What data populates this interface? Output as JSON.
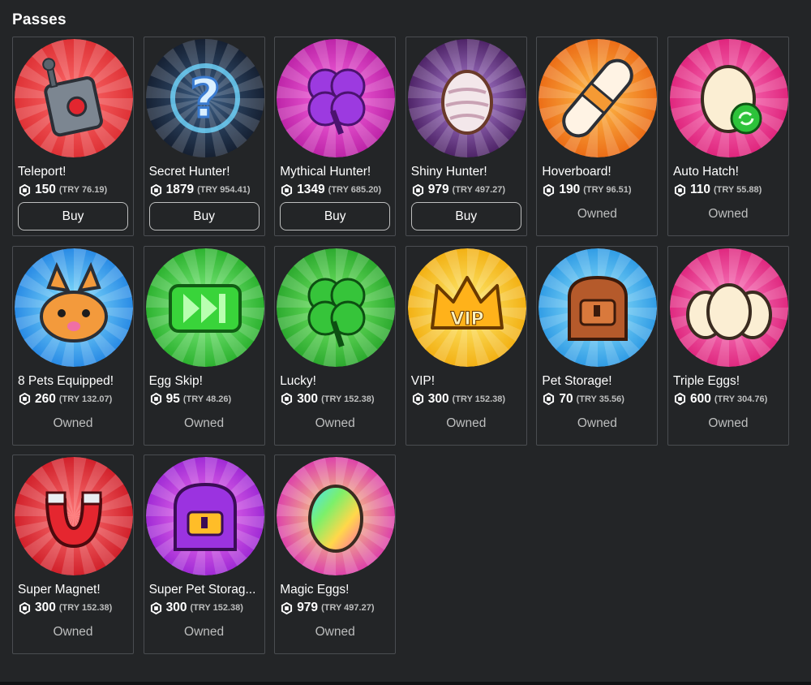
{
  "section_title": "Passes",
  "currency_icon": "robux-icon",
  "passes": [
    {
      "name": "Teleport!",
      "price": "150",
      "local_price": "(TRY 76.19)",
      "status": "buy",
      "button_label": "Buy",
      "icon": "teleport-icon",
      "bg": [
        "#ff6f6f",
        "#d8262b"
      ]
    },
    {
      "name": "Secret Hunter!",
      "price": "1879",
      "local_price": "(TRY 954.41)",
      "status": "buy",
      "button_label": "Buy",
      "icon": "secret-hunter-icon",
      "bg": [
        "#3d5f86",
        "#0e1422"
      ]
    },
    {
      "name": "Mythical Hunter!",
      "price": "1349",
      "local_price": "(TRY 685.20)",
      "status": "buy",
      "button_label": "Buy",
      "icon": "mythical-hunter-icon",
      "bg": [
        "#ff6ee6",
        "#b0169c"
      ]
    },
    {
      "name": "Shiny Hunter!",
      "price": "979",
      "local_price": "(TRY 497.27)",
      "status": "buy",
      "button_label": "Buy",
      "icon": "shiny-hunter-icon",
      "bg": [
        "#b88be0",
        "#3a1050"
      ]
    },
    {
      "name": "Hoverboard!",
      "price": "190",
      "local_price": "(TRY 96.51)",
      "status": "owned",
      "owned_label": "Owned",
      "icon": "hoverboard-icon",
      "bg": [
        "#ffc04d",
        "#e85d0c"
      ]
    },
    {
      "name": "Auto Hatch!",
      "price": "110",
      "local_price": "(TRY 55.88)",
      "status": "owned",
      "owned_label": "Owned",
      "icon": "auto-hatch-icon",
      "bg": [
        "#ff7fc4",
        "#d9146f"
      ]
    },
    {
      "name": "8 Pets Equipped!",
      "price": "260",
      "local_price": "(TRY 132.07)",
      "status": "owned",
      "owned_label": "Owned",
      "icon": "pets-equipped-icon",
      "bg": [
        "#8fe9ff",
        "#1578e0"
      ]
    },
    {
      "name": "Egg Skip!",
      "price": "95",
      "local_price": "(TRY 48.26)",
      "status": "owned",
      "owned_label": "Owned",
      "icon": "egg-skip-icon",
      "bg": [
        "#8cf58a",
        "#1aa51e"
      ]
    },
    {
      "name": "Lucky!",
      "price": "300",
      "local_price": "(TRY 152.38)",
      "status": "owned",
      "owned_label": "Owned",
      "icon": "lucky-icon",
      "bg": [
        "#7ff06f",
        "#1c9c22"
      ]
    },
    {
      "name": "VIP!",
      "price": "300",
      "local_price": "(TRY 152.38)",
      "status": "owned",
      "owned_label": "Owned",
      "icon": "vip-icon",
      "bg": [
        "#fff07a",
        "#f0a400"
      ]
    },
    {
      "name": "Pet Storage!",
      "price": "70",
      "local_price": "(TRY 35.56)",
      "status": "owned",
      "owned_label": "Owned",
      "icon": "pet-storage-icon",
      "bg": [
        "#9eeeff",
        "#1b8ce0"
      ]
    },
    {
      "name": "Triple Eggs!",
      "price": "600",
      "local_price": "(TRY 304.76)",
      "status": "owned",
      "owned_label": "Owned",
      "icon": "triple-eggs-icon",
      "bg": [
        "#ff8fcc",
        "#d91470"
      ]
    },
    {
      "name": "Super Magnet!",
      "price": "300",
      "local_price": "(TRY 152.38)",
      "status": "owned",
      "owned_label": "Owned",
      "icon": "super-magnet-icon",
      "bg": [
        "#ff7777",
        "#c8101c"
      ]
    },
    {
      "name": "Super Pet Storag...",
      "price": "300",
      "local_price": "(TRY 152.38)",
      "status": "owned",
      "owned_label": "Owned",
      "icon": "super-pet-storage-icon",
      "bg": [
        "#ff7ff0",
        "#8d1ad0"
      ]
    },
    {
      "name": "Magic Eggs!",
      "price": "979",
      "local_price": "(TRY 497.27)",
      "status": "owned",
      "owned_label": "Owned",
      "icon": "magic-eggs-icon",
      "bg": [
        "#fff176",
        "#d620b4"
      ]
    }
  ]
}
